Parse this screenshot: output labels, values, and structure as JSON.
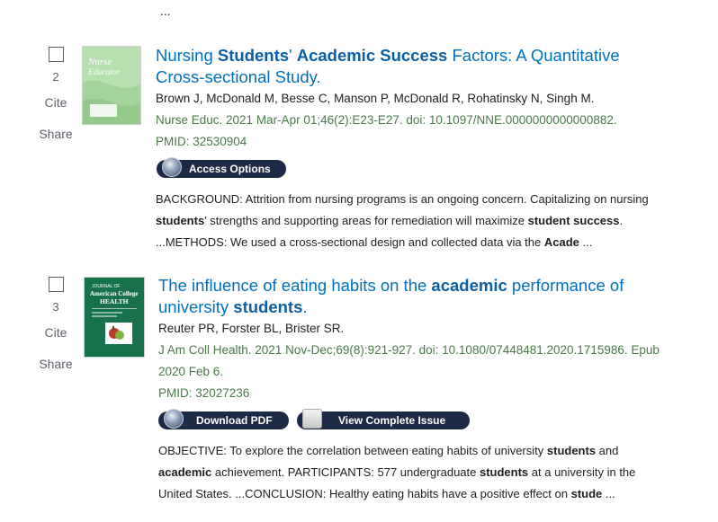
{
  "ellipsis": "...",
  "results": [
    {
      "number": "2",
      "cite": "Cite",
      "share": "Share",
      "thumb_text": "Nurse Educator",
      "title_parts": [
        {
          "text": "Nursing ",
          "bold": false
        },
        {
          "text": "Students",
          "bold": true
        },
        {
          "text": "' ",
          "bold": false
        },
        {
          "text": "Academic Success",
          "bold": true
        },
        {
          "text": " Factors: A Quantitative Cross-sectional Study.",
          "bold": false
        }
      ],
      "authors": "Brown J, McDonald M, Besse C, Manson P, McDonald R, Rohatinsky N, Singh M.",
      "citation": "Nurse Educ. 2021 Mar-Apr 01;46(2):E23-E27. doi: 10.1097/NNE.0000000000000882.",
      "pmid": "PMID: 32530904",
      "buttons": [
        {
          "label": "Access Options",
          "icon": "globe-icon"
        }
      ],
      "snippet_parts": [
        {
          "text": "BACKGROUND: Attrition from nursing programs is an ongoing concern. Capitalizing on nursing ",
          "bold": false
        },
        {
          "text": "students",
          "bold": true
        },
        {
          "text": "' strengths and supporting areas for remediation will maximize ",
          "bold": false
        },
        {
          "text": "student success",
          "bold": true
        },
        {
          "text": ". ...METHODS: We used a cross-sectional design and collected data via the ",
          "bold": false
        },
        {
          "text": "Acade",
          "bold": true
        },
        {
          "text": " ...",
          "bold": false
        }
      ]
    },
    {
      "number": "3",
      "cite": "Cite",
      "share": "Share",
      "thumb_text": "American College HEALTH",
      "title_parts": [
        {
          "text": "The influence of eating habits on the ",
          "bold": false
        },
        {
          "text": "academic",
          "bold": true
        },
        {
          "text": " performance of university ",
          "bold": false
        },
        {
          "text": "students",
          "bold": true
        },
        {
          "text": ".",
          "bold": false
        }
      ],
      "authors": "Reuter PR, Forster BL, Brister SR.",
      "citation": "J Am Coll Health. 2021 Nov-Dec;69(8):921-927. doi: 10.1080/07448481.2020.1715986. Epub 2020 Feb 6.",
      "pmid": "PMID: 32027236",
      "buttons": [
        {
          "label": "Download PDF",
          "icon": "globe-icon"
        },
        {
          "label": "View Complete Issue",
          "icon": "book-icon"
        }
      ],
      "snippet_parts": [
        {
          "text": "OBJECTIVE: To explore the correlation between eating habits of university ",
          "bold": false
        },
        {
          "text": "students",
          "bold": true
        },
        {
          "text": " and ",
          "bold": false
        },
        {
          "text": "academic",
          "bold": true
        },
        {
          "text": " achievement. PARTICIPANTS: 577 undergraduate ",
          "bold": false
        },
        {
          "text": "students",
          "bold": true
        },
        {
          "text": " at a university in the United States. ...CONCLUSION: Healthy eating habits have a positive effect on ",
          "bold": false
        },
        {
          "text": "stude",
          "bold": true
        },
        {
          "text": " ...",
          "bold": false
        }
      ]
    }
  ]
}
